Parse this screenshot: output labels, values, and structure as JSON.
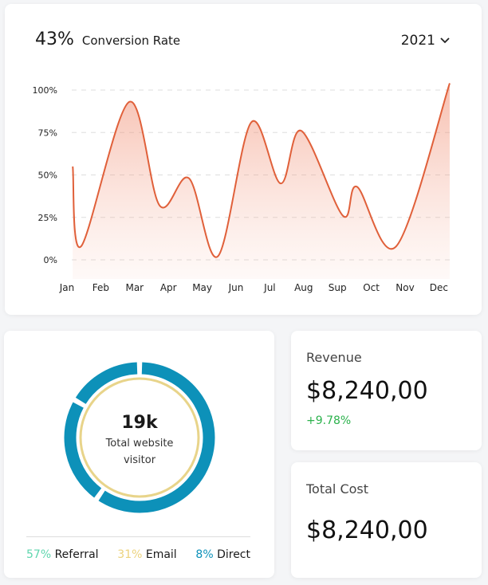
{
  "header": {
    "value": "43%",
    "label": "Conversion Rate",
    "year": "2021"
  },
  "chart_data": {
    "type": "area",
    "title": "Conversion Rate",
    "categories": [
      "Jan",
      "Feb",
      "Mar",
      "Apr",
      "May",
      "Jun",
      "Jul",
      "Aug",
      "Sup",
      "Oct",
      "Nov",
      "Dec"
    ],
    "y_ticks": [
      "100%",
      "75%",
      "50%",
      "25%",
      "0%"
    ],
    "ylim": [
      0,
      100
    ],
    "grid": true,
    "line_color": "#e0603a",
    "points": [
      [
        1.17,
        55
      ],
      [
        1.42,
        8
      ],
      [
        2.84,
        93
      ],
      [
        3.74,
        32
      ],
      [
        4.61,
        48
      ],
      [
        5.46,
        2
      ],
      [
        6.45,
        81
      ],
      [
        7.32,
        45
      ],
      [
        7.93,
        76
      ],
      [
        9.16,
        26
      ],
      [
        9.58,
        43
      ],
      [
        10.74,
        8
      ],
      [
        12.32,
        107
      ]
    ]
  },
  "donut": {
    "total": "19k",
    "caption1": "Total website",
    "caption2": "visitor",
    "ring_color": "#0d91b9",
    "inner_color": "#e8d48a",
    "legend": [
      {
        "pct": "57%",
        "label": "Referral",
        "color": "#5fd6ae"
      },
      {
        "pct": "31%",
        "label": "Email",
        "color": "#ecd37d"
      },
      {
        "pct": "8%",
        "label": "Direct",
        "color": "#0d91b9"
      }
    ]
  },
  "revenue": {
    "title": "Revenue",
    "value": "$8,240,00",
    "delta": "+9.78%"
  },
  "cost": {
    "title": "Total Cost",
    "value": "$8,240,00"
  }
}
